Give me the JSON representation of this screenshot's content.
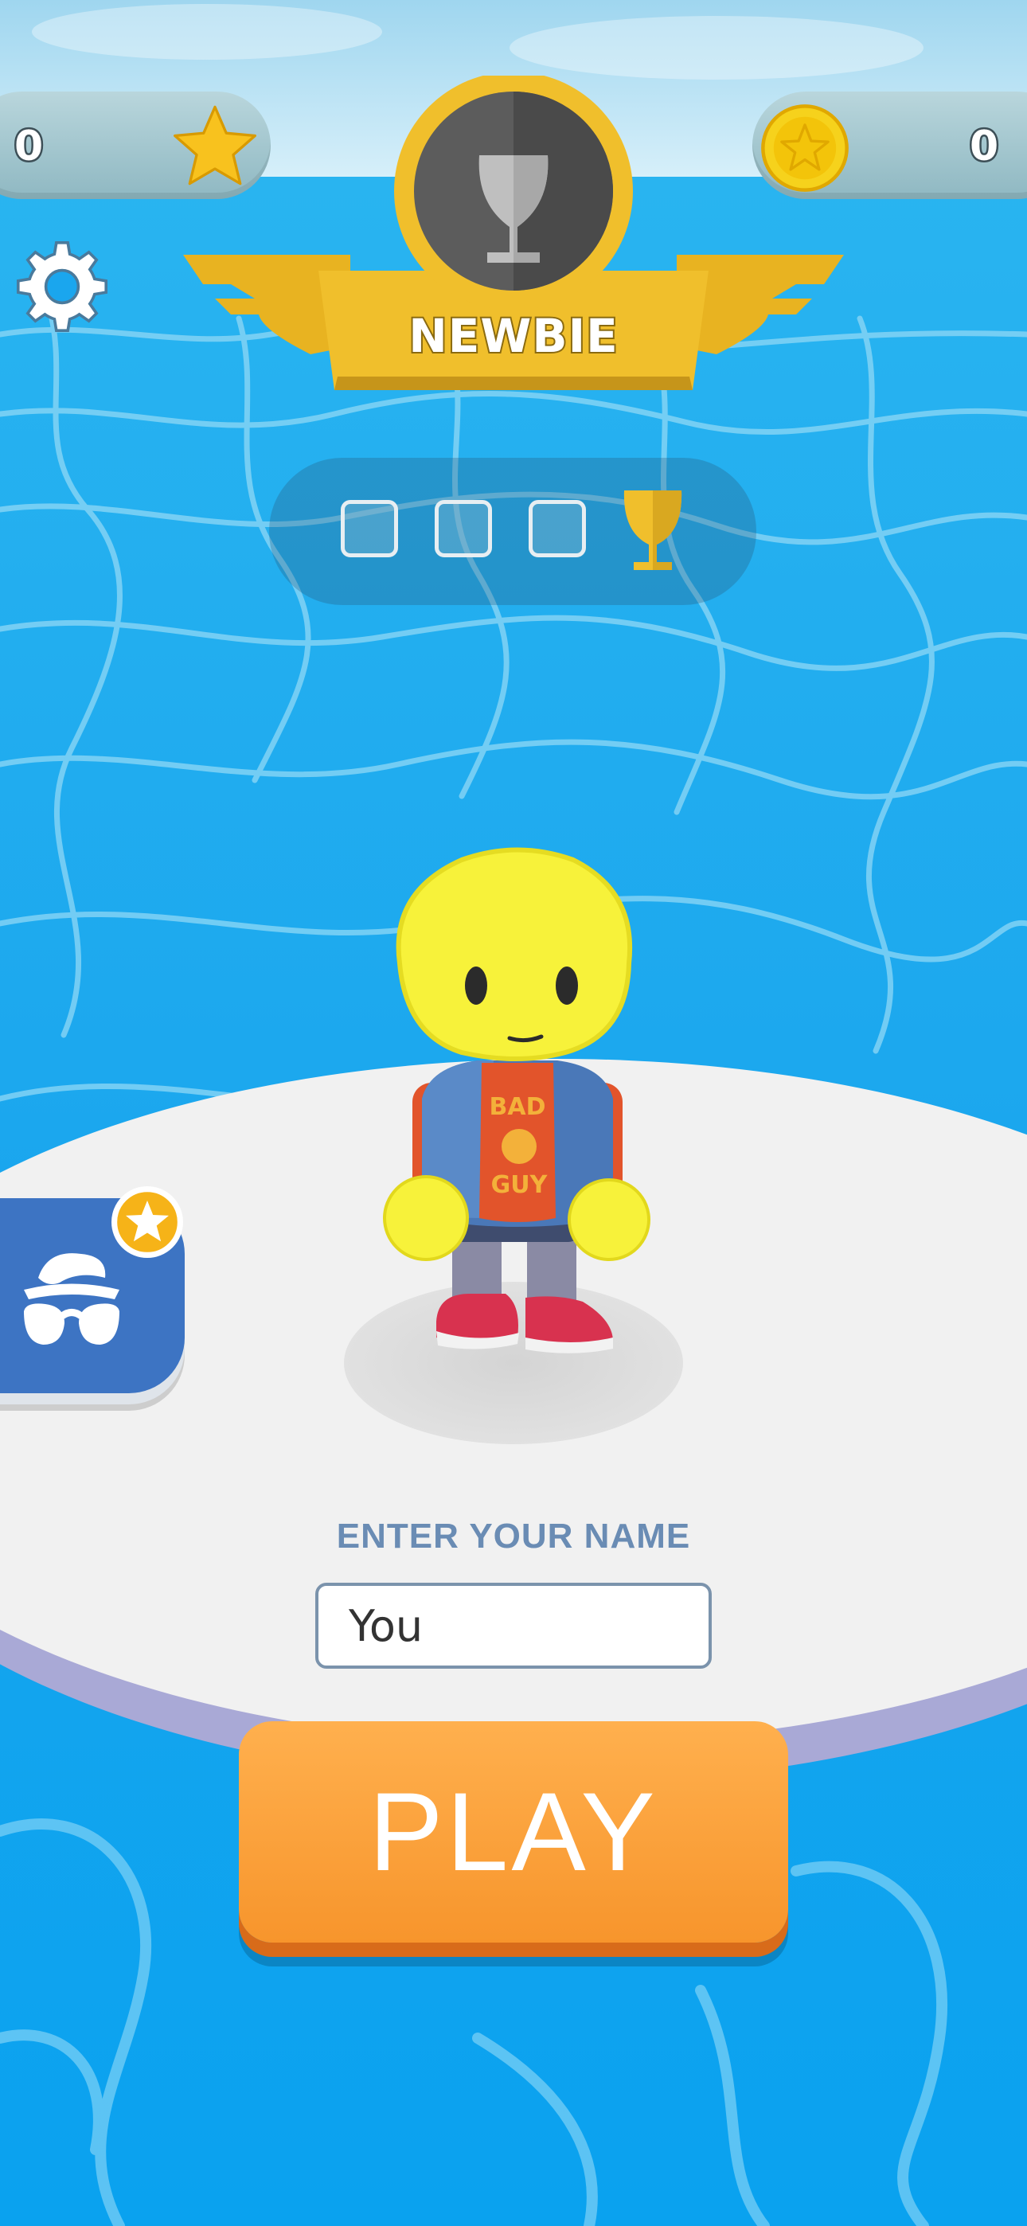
{
  "currency": {
    "stars": "0",
    "coins": "0"
  },
  "rank": {
    "label": "NEWBIE",
    "progress_filled": 0,
    "progress_total": 3
  },
  "profile": {
    "name_label": "ENTER YOUR NAME",
    "name_value": "You"
  },
  "play_button": {
    "label": "PLAY"
  },
  "character": {
    "shirt_text_top": "BAD",
    "shirt_text_bottom": "GUY"
  },
  "colors": {
    "sea": "#1aa6ee",
    "platform": "#f1f1f1",
    "gold": "#f0bf2c",
    "play": "#f7952c",
    "outfit_button": "#3d74c3"
  },
  "icons": {
    "settings": "gear-icon",
    "stars": "star-icon",
    "coins": "coin-icon",
    "rank": "trophy-icon",
    "outfit": "disguise-icon"
  }
}
